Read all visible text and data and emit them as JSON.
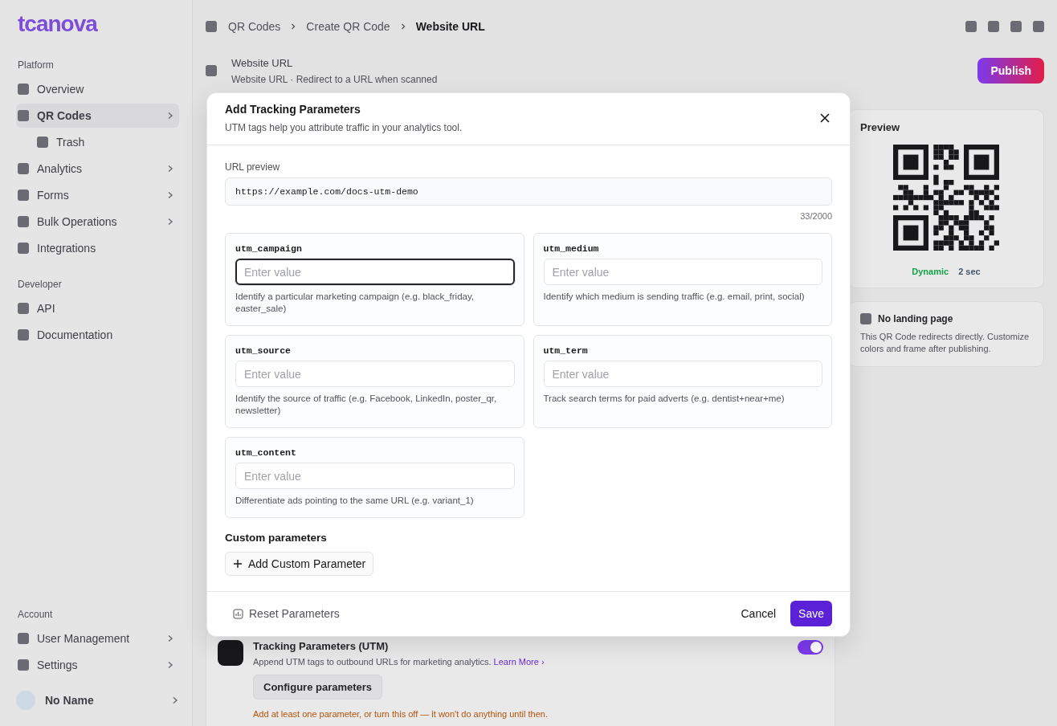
{
  "sidebar": {
    "logo": "tcanova",
    "sections": [
      {
        "heading": "Platform",
        "items": [
          {
            "label": "Overview",
            "selected": false,
            "expandable": false
          },
          {
            "label": "QR Codes",
            "selected": true,
            "expandable": true,
            "children": [
              {
                "label": "Trash"
              }
            ]
          },
          {
            "label": "Analytics",
            "selected": false,
            "expandable": true
          },
          {
            "label": "Forms",
            "selected": false,
            "expandable": true
          },
          {
            "label": "Bulk Operations",
            "selected": false,
            "expandable": true
          },
          {
            "label": "Integrations",
            "selected": false,
            "expandable": false
          }
        ]
      },
      {
        "heading": "Developer",
        "items": [
          {
            "label": "API",
            "selected": false,
            "expandable": false
          },
          {
            "label": "Documentation",
            "selected": false,
            "expandable": false
          }
        ]
      },
      {
        "heading": "Account",
        "items": [
          {
            "label": "User Management",
            "selected": false,
            "expandable": true
          },
          {
            "label": "Settings",
            "selected": false,
            "expandable": true
          }
        ]
      }
    ],
    "user": {
      "name": "No Name"
    }
  },
  "breadcrumbs": [
    "QR Codes",
    "Create QR Code",
    "Website URL"
  ],
  "header": {
    "title": "Website URL",
    "subtitle": "Website URL · Redirect to a URL when scanned",
    "publish": "Publish"
  },
  "preview": {
    "title": "Preview",
    "badges": [
      {
        "label": "Dynamic",
        "color": "#16a34a"
      },
      {
        "label": "2 sec",
        "color": "#475569"
      }
    ]
  },
  "landing": {
    "title": "No landing page",
    "text": "This QR Code redirects directly. Customize colors and frame after publishing."
  },
  "tracking": {
    "title": "Tracking Parameters (UTM)",
    "text": "Append UTM tags to outbound URLs for marketing analytics.",
    "link": "Learn More ›",
    "on": true,
    "configure": "Configure parameters",
    "warning": "Add at least one parameter, or turn this off — it won't do anything until then."
  },
  "dialog": {
    "title": "Add Tracking Parameters",
    "subtitle": "UTM tags help you attribute traffic in your analytics tool.",
    "url_label": "URL preview",
    "url": "https://example.com/docs-utm-demo",
    "count": "33/2000",
    "fields": [
      {
        "name": "utm_campaign",
        "placeholder": "Enter value",
        "focused": true,
        "help": "Identify a particular marketing campaign (e.g. black_friday, easter_sale)"
      },
      {
        "name": "utm_medium",
        "placeholder": "Enter value",
        "focused": false,
        "help": "Identify which medium is sending traffic (e.g. email, print, social)"
      },
      {
        "name": "utm_source",
        "placeholder": "Enter value",
        "focused": false,
        "help": "Identify the source of traffic (e.g. Facebook, LinkedIn, poster_qr, newsletter)"
      },
      {
        "name": "utm_term",
        "placeholder": "Enter value",
        "focused": false,
        "help": "Track search terms for paid adverts (e.g. dentist+near+me)"
      },
      {
        "name": "utm_content",
        "placeholder": "Enter value",
        "focused": false,
        "help": "Differentiate ads pointing to the same URL (e.g. variant_1)"
      }
    ],
    "custom_heading": "Custom parameters",
    "add_button": "Add Custom Parameter",
    "reset": "Reset Parameters",
    "cancel": "Cancel",
    "save": "Save"
  }
}
